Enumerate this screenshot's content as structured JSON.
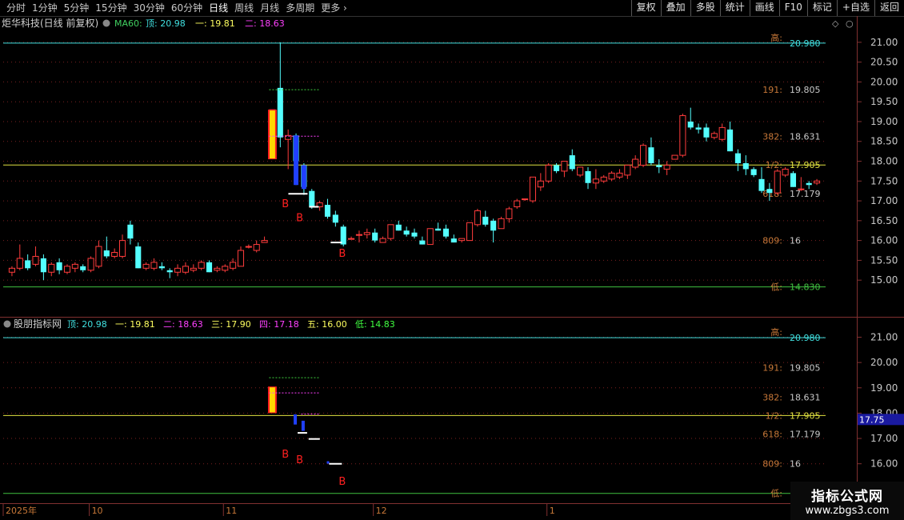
{
  "toolbar": {
    "left_items": [
      "分时",
      "1分钟",
      "5分钟",
      "15分钟",
      "30分钟",
      "60分钟",
      "日线",
      "周线",
      "月线",
      "多周期",
      "更多 ›"
    ],
    "active_index": 6,
    "right_items": [
      "复权",
      "叠加",
      "多股",
      "统计",
      "画线",
      "F10",
      "标记",
      "+自选",
      "返回"
    ]
  },
  "main_panel": {
    "title": "炬华科技(日线 前复权)",
    "ma_label": "MA60:",
    "legend": [
      {
        "label": "顶: 20.98",
        "color": "#40e0e0"
      },
      {
        "label": "一: 19.81",
        "color": "#ffff60"
      },
      {
        "label": "二: 18.63",
        "color": "#ff40ff"
      }
    ],
    "y_axis": [
      "21.00",
      "20.50",
      "20.00",
      "19.50",
      "19.00",
      "18.50",
      "18.00",
      "17.50",
      "17.00",
      "16.50",
      "16.00",
      "15.50",
      "15.00"
    ],
    "levels": [
      {
        "tag": "高:",
        "value": "20.980",
        "price": 20.98,
        "color": "#40e0e0"
      },
      {
        "tag": "191:",
        "value": "19.805",
        "price": 19.805,
        "color": "#c08040"
      },
      {
        "tag": "382:",
        "value": "18.631",
        "price": 18.631,
        "color": "#c08040"
      },
      {
        "tag": "1/2:",
        "value": "17.905",
        "price": 17.905,
        "color": "#e0e040"
      },
      {
        "tag": "618:",
        "value": "17.179",
        "price": 17.179,
        "color": "#c08040"
      },
      {
        "tag": "809:",
        "value": "16",
        "price": 16.0,
        "color": "#c08040"
      },
      {
        "tag": "低:",
        "value": "14.830",
        "price": 14.83,
        "color": "#40c040"
      }
    ],
    "b_marks": [
      {
        "label": "B",
        "idx": 34
      },
      {
        "label": "B",
        "idx": 35
      },
      {
        "label": "B",
        "idx": 41
      }
    ]
  },
  "sub_panel": {
    "title": "股朋指标网",
    "legend": [
      {
        "label": "顶: 20.98",
        "color": "#40e0e0"
      },
      {
        "label": "一: 19.81",
        "color": "#ffff60"
      },
      {
        "label": "二: 18.63",
        "color": "#ff40ff"
      },
      {
        "label": "三: 17.90",
        "color": "#ffff60"
      },
      {
        "label": "四: 17.18",
        "color": "#ff40ff"
      },
      {
        "label": "五: 16.00",
        "color": "#ffff60"
      },
      {
        "label": "低: 14.83",
        "color": "#40ff40"
      }
    ],
    "y_axis": [
      "21.00",
      "20.00",
      "19.00",
      "18.00",
      "17.00",
      "16.00"
    ],
    "levels": [
      {
        "tag": "高:",
        "value": "20.980",
        "price": 20.98,
        "color": "#40e0e0"
      },
      {
        "tag": "191:",
        "value": "19.805",
        "price": 19.805,
        "color": "#c08040"
      },
      {
        "tag": "382:",
        "value": "18.631",
        "price": 18.631,
        "color": "#c08040"
      },
      {
        "tag": "1/2:",
        "value": "17.905",
        "price": 17.905,
        "color": "#e0e040"
      },
      {
        "tag": "618:",
        "value": "17.179",
        "price": 17.179,
        "color": "#c08040"
      },
      {
        "tag": "809:",
        "value": "16",
        "price": 16.0,
        "color": "#c08040"
      },
      {
        "tag": "低:",
        "value": "",
        "price": 14.83,
        "color": "#40c040"
      }
    ],
    "price_badge": "17.75",
    "b_marks": [
      {
        "label": "B",
        "idx": 34
      },
      {
        "label": "B",
        "idx": 35
      },
      {
        "label": "B",
        "idx": 41
      }
    ]
  },
  "x_axis": [
    {
      "label": "2025年",
      "idx": 0
    },
    {
      "label": "10",
      "idx": 10
    },
    {
      "label": "11",
      "idx": 27
    },
    {
      "label": "12",
      "idx": 46
    },
    {
      "label": "1",
      "idx": 68
    }
  ],
  "watermark": {
    "line1": "指标公式网",
    "line2": "www.zbgs3.com"
  },
  "chart_data": {
    "type": "candlestick",
    "ohlc": [
      [
        15.2,
        15.35,
        15.1,
        15.3
      ],
      [
        15.3,
        15.9,
        15.25,
        15.55
      ],
      [
        15.5,
        15.65,
        15.25,
        15.3
      ],
      [
        15.4,
        15.85,
        15.35,
        15.6
      ],
      [
        15.55,
        15.65,
        15.0,
        15.2
      ],
      [
        15.2,
        15.45,
        15.1,
        15.4
      ],
      [
        15.45,
        15.55,
        15.15,
        15.25
      ],
      [
        15.2,
        15.4,
        15.15,
        15.35
      ],
      [
        15.3,
        15.45,
        15.2,
        15.4
      ],
      [
        15.35,
        15.4,
        15.2,
        15.25
      ],
      [
        15.25,
        15.6,
        15.2,
        15.55
      ],
      [
        15.35,
        16.0,
        15.3,
        15.85
      ],
      [
        15.75,
        16.1,
        15.55,
        15.6
      ],
      [
        15.6,
        15.8,
        15.55,
        15.7
      ],
      [
        15.6,
        16.15,
        15.55,
        16.0
      ],
      [
        16.4,
        16.5,
        15.9,
        16.05
      ],
      [
        15.85,
        15.95,
        15.3,
        15.3
      ],
      [
        15.3,
        15.45,
        15.25,
        15.4
      ],
      [
        15.3,
        15.55,
        15.25,
        15.45
      ],
      [
        15.35,
        15.45,
        15.25,
        15.3
      ],
      [
        15.25,
        15.3,
        15.05,
        15.2
      ],
      [
        15.2,
        15.4,
        15.1,
        15.3
      ],
      [
        15.2,
        15.45,
        15.15,
        15.35
      ],
      [
        15.25,
        15.4,
        15.2,
        15.3
      ],
      [
        15.3,
        15.5,
        15.25,
        15.45
      ],
      [
        15.45,
        15.5,
        15.2,
        15.2
      ],
      [
        15.25,
        15.35,
        15.2,
        15.3
      ],
      [
        15.25,
        15.4,
        15.2,
        15.35
      ],
      [
        15.3,
        15.55,
        15.25,
        15.45
      ],
      [
        15.35,
        15.85,
        15.35,
        15.75
      ],
      [
        15.85,
        15.9,
        15.8,
        15.85
      ],
      [
        15.75,
        16.0,
        15.7,
        15.9
      ],
      [
        15.95,
        16.1,
        15.95,
        16.0
      ],
      [
        18.1,
        19.3,
        18.05,
        19.3
      ],
      [
        19.85,
        21.0,
        18.35,
        18.6
      ],
      [
        18.55,
        18.8,
        17.8,
        18.65
      ],
      [
        18.65,
        18.7,
        17.4,
        18.0
      ],
      [
        17.9,
        17.95,
        17.15,
        17.35
      ],
      [
        17.25,
        17.3,
        16.8,
        16.85
      ],
      [
        16.85,
        17.0,
        16.75,
        16.95
      ],
      [
        16.9,
        17.05,
        16.55,
        16.6
      ],
      [
        16.65,
        16.75,
        16.35,
        16.45
      ],
      [
        16.35,
        16.4,
        15.85,
        15.9
      ],
      [
        16.05,
        16.1,
        16.05,
        16.05
      ],
      [
        16.15,
        16.25,
        15.95,
        16.15
      ],
      [
        16.15,
        16.3,
        16.05,
        16.2
      ],
      [
        16.2,
        16.3,
        15.95,
        16.0
      ],
      [
        15.95,
        16.1,
        15.95,
        16.05
      ],
      [
        16.05,
        16.4,
        16.0,
        16.4
      ],
      [
        16.4,
        16.5,
        16.25,
        16.25
      ],
      [
        16.25,
        16.35,
        16.1,
        16.15
      ],
      [
        16.2,
        16.3,
        16.05,
        16.1
      ],
      [
        16.0,
        16.1,
        15.9,
        15.9
      ],
      [
        15.9,
        16.3,
        15.9,
        16.3
      ],
      [
        16.3,
        16.45,
        16.25,
        16.25
      ],
      [
        16.3,
        16.4,
        16.05,
        16.1
      ],
      [
        16.05,
        16.15,
        15.95,
        15.95
      ],
      [
        16.0,
        16.05,
        15.95,
        16.05
      ],
      [
        16.0,
        16.45,
        16.0,
        16.45
      ],
      [
        16.4,
        16.8,
        16.35,
        16.75
      ],
      [
        16.6,
        16.75,
        16.35,
        16.4
      ],
      [
        16.5,
        16.55,
        15.95,
        16.25
      ],
      [
        16.3,
        16.6,
        16.3,
        16.55
      ],
      [
        16.55,
        16.85,
        16.45,
        16.8
      ],
      [
        16.85,
        17.05,
        16.8,
        17.0
      ],
      [
        17.05,
        17.05,
        17.0,
        17.05
      ],
      [
        17.0,
        17.55,
        16.95,
        17.6
      ],
      [
        17.35,
        17.7,
        17.25,
        17.5
      ],
      [
        17.5,
        17.95,
        17.45,
        17.9
      ],
      [
        17.9,
        17.95,
        17.7,
        17.75
      ],
      [
        17.75,
        18.0,
        17.6,
        18.0
      ],
      [
        18.15,
        18.3,
        17.75,
        17.8
      ],
      [
        17.65,
        17.85,
        17.6,
        17.85
      ],
      [
        17.75,
        17.85,
        17.3,
        17.45
      ],
      [
        17.45,
        17.8,
        17.3,
        17.55
      ],
      [
        17.5,
        17.65,
        17.45,
        17.6
      ],
      [
        17.55,
        17.75,
        17.5,
        17.7
      ],
      [
        17.6,
        17.8,
        17.55,
        17.7
      ],
      [
        17.65,
        17.9,
        17.55,
        17.9
      ],
      [
        17.85,
        18.15,
        17.8,
        18.05
      ],
      [
        17.9,
        18.45,
        17.85,
        18.4
      ],
      [
        18.35,
        18.6,
        17.9,
        17.95
      ],
      [
        17.9,
        18.05,
        17.7,
        17.85
      ],
      [
        17.8,
        18.0,
        17.65,
        17.9
      ],
      [
        18.05,
        18.15,
        18.1,
        18.15
      ],
      [
        18.15,
        19.2,
        18.1,
        19.15
      ],
      [
        19.0,
        19.35,
        18.8,
        18.85
      ],
      [
        18.85,
        18.95,
        18.7,
        18.8
      ],
      [
        18.85,
        18.95,
        18.5,
        18.6
      ],
      [
        18.6,
        18.75,
        18.55,
        18.7
      ],
      [
        18.55,
        18.95,
        18.5,
        18.85
      ],
      [
        18.8,
        19.0,
        18.25,
        18.25
      ],
      [
        18.2,
        18.3,
        17.75,
        17.95
      ],
      [
        17.95,
        18.15,
        17.65,
        17.8
      ],
      [
        17.8,
        17.85,
        17.6,
        17.65
      ],
      [
        17.55,
        17.85,
        17.2,
        17.25
      ],
      [
        17.3,
        17.45,
        17.0,
        17.2
      ],
      [
        17.2,
        17.8,
        17.15,
        17.75
      ],
      [
        17.65,
        17.85,
        17.6,
        17.8
      ],
      [
        17.7,
        17.75,
        17.35,
        17.35
      ],
      [
        17.3,
        17.6,
        17.25,
        17.3
      ],
      [
        17.45,
        17.5,
        17.3,
        17.4
      ],
      [
        17.45,
        17.55,
        17.4,
        17.5
      ]
    ],
    "y_range_main": [
      14.6,
      21.3
    ],
    "y_range_sub": [
      14.6,
      21.3
    ]
  }
}
